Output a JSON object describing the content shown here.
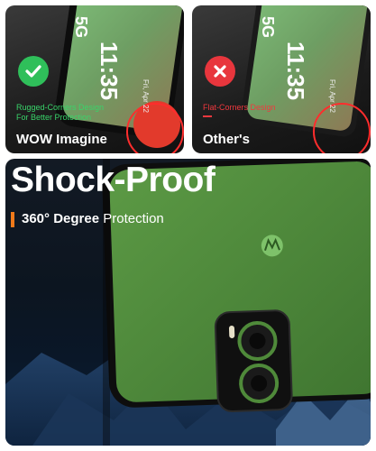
{
  "left_panel": {
    "caption_line1": "Rugged-Corners Design",
    "caption_line2": "For Better Protection",
    "title": "WOW Imagine",
    "badge_icon": "check-icon",
    "accent": "#2fbf5a"
  },
  "right_panel": {
    "caption_line1": "Flat-Corners Design",
    "title": "Other's",
    "badge_icon": "cross-icon",
    "accent": "#e8363d"
  },
  "phone_screen": {
    "time": "11:35",
    "network": "5G",
    "date": "Fri, Apr 22"
  },
  "hero": {
    "headline": "Shock-Proof",
    "sub_bold": "360° Degree",
    "sub_regular": " Protection",
    "accent": "#f07a1a"
  },
  "colors": {
    "phone_green": "#4f8a3a",
    "case_black": "#101010"
  }
}
